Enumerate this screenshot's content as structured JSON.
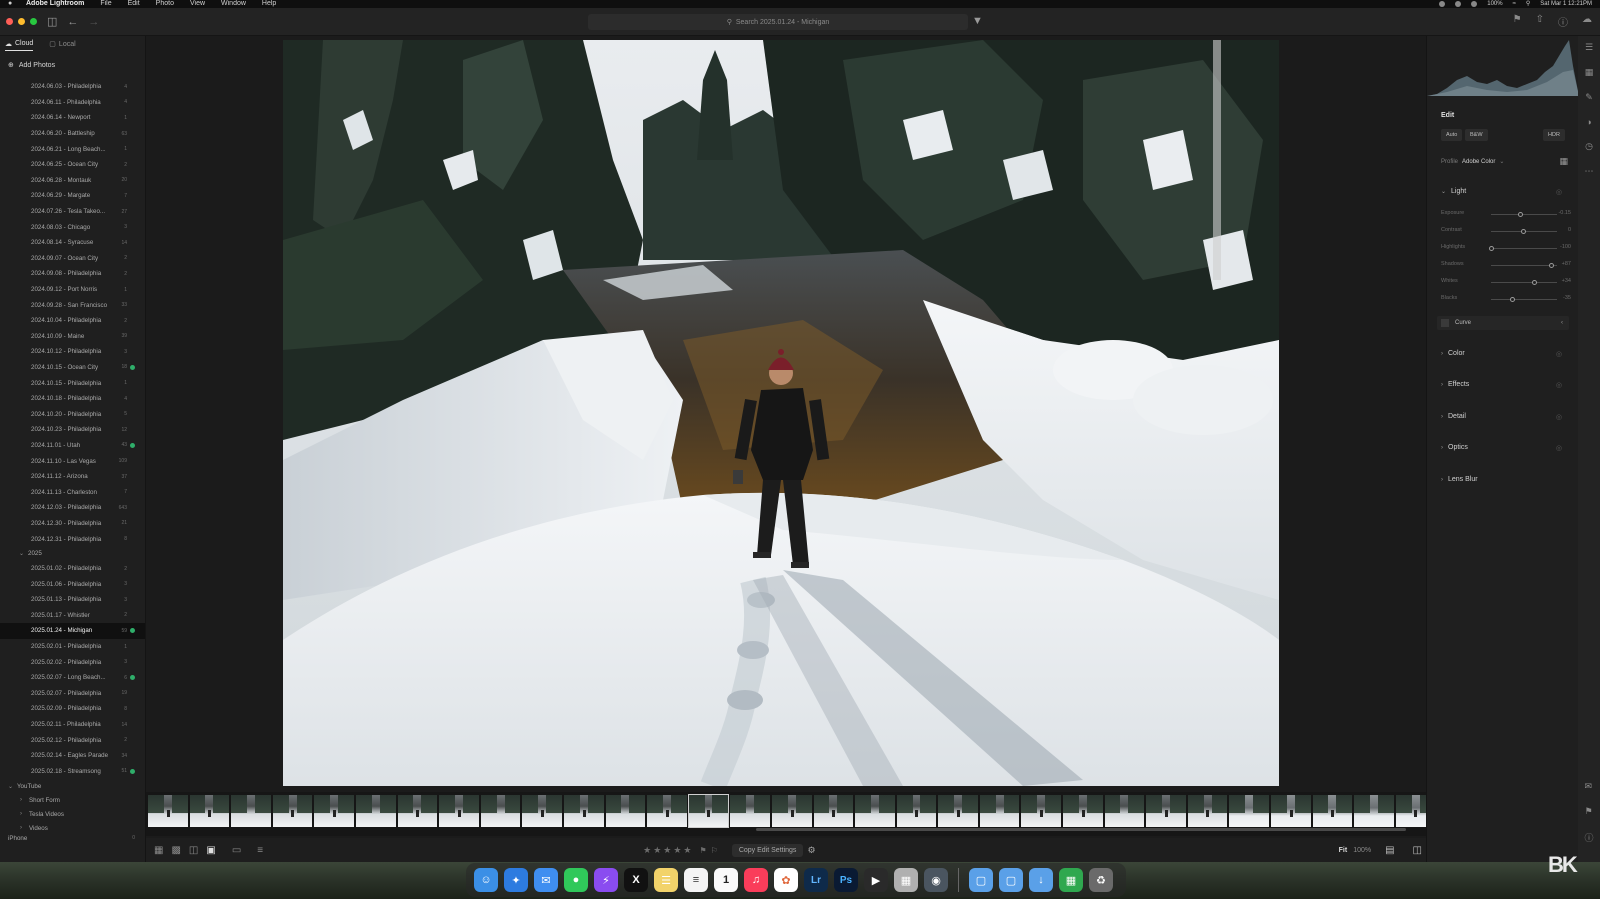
{
  "menubar": {
    "app_name": "Adobe Lightroom",
    "menus": [
      "File",
      "Edit",
      "Photo",
      "View",
      "Window",
      "Help"
    ],
    "battery": "100%",
    "datetime": "Sat Mar 1  12:21PM"
  },
  "topbar": {
    "search_placeholder": "Search 2025.01.24 - Michigan"
  },
  "left_panel": {
    "tabs": [
      {
        "label": "Cloud",
        "active": true
      },
      {
        "label": "Local",
        "active": false
      }
    ],
    "add_photos_label": "Add Photos",
    "albums_2024": [
      {
        "name": "2024.06.03 - Philadelphia",
        "count": "4"
      },
      {
        "name": "2024.06.11 - Philadelphia",
        "count": "4"
      },
      {
        "name": "2024.06.14 - Newport",
        "count": "1"
      },
      {
        "name": "2024.06.20 - Battleship",
        "count": "63"
      },
      {
        "name": "2024.06.21 - Long Beach...",
        "count": "1"
      },
      {
        "name": "2024.06.25 - Ocean City",
        "count": "2"
      },
      {
        "name": "2024.06.28 - Montauk",
        "count": "20"
      },
      {
        "name": "2024.06.29 - Margate",
        "count": "7"
      },
      {
        "name": "2024.07.26 - Tesla Takeo...",
        "count": "27"
      },
      {
        "name": "2024.08.03 - Chicago",
        "count": "3"
      },
      {
        "name": "2024.08.14 - Syracuse",
        "count": "14"
      },
      {
        "name": "2024.09.07 - Ocean City",
        "count": "2"
      },
      {
        "name": "2024.09.08 - Philadelphia",
        "count": "2"
      },
      {
        "name": "2024.09.12 - Port Norris",
        "count": "1"
      },
      {
        "name": "2024.09.28 - San Francisco",
        "count": "33"
      },
      {
        "name": "2024.10.04 - Philadelphia",
        "count": "2"
      },
      {
        "name": "2024.10.09 - Maine",
        "count": "39"
      },
      {
        "name": "2024.10.12 - Philadelphia",
        "count": "3"
      },
      {
        "name": "2024.10.15 - Ocean City",
        "count": "18",
        "synced": true
      },
      {
        "name": "2024.10.15 - Philadelphia",
        "count": "1"
      },
      {
        "name": "2024.10.18 - Philadelphia",
        "count": "4"
      },
      {
        "name": "2024.10.20 - Philadelphia",
        "count": "5"
      },
      {
        "name": "2024.10.23 - Philadelphia",
        "count": "12"
      },
      {
        "name": "2024.11.01 - Utah",
        "count": "43",
        "synced": true
      },
      {
        "name": "2024.11.10 - Las Vegas",
        "count": "109"
      },
      {
        "name": "2024.11.12 - Arizona",
        "count": "37"
      },
      {
        "name": "2024.11.13 - Charleston",
        "count": "7"
      },
      {
        "name": "2024.12.03 - Philadelphia",
        "count": "643"
      },
      {
        "name": "2024.12.30 - Philadelphia",
        "count": "21"
      },
      {
        "name": "2024.12.31 - Philadelphia",
        "count": "8"
      }
    ],
    "year_2025_label": "2025",
    "albums_2025": [
      {
        "name": "2025.01.02 - Philadelphia",
        "count": "2"
      },
      {
        "name": "2025.01.06 - Philadelphia",
        "count": "3"
      },
      {
        "name": "2025.01.13 - Philadelphia",
        "count": "3"
      },
      {
        "name": "2025.01.17 - Whistler",
        "count": "2"
      },
      {
        "name": "2025.01.24 - Michigan",
        "count": "59",
        "synced": true,
        "active": true
      },
      {
        "name": "2025.02.01 - Philadelphia",
        "count": "1"
      },
      {
        "name": "2025.02.02 - Philadelphia",
        "count": "3"
      },
      {
        "name": "2025.02.07 - Long Beach...",
        "count": "6",
        "synced": true
      },
      {
        "name": "2025.02.07 - Philadelphia",
        "count": "19"
      },
      {
        "name": "2025.02.09 - Philadelphia",
        "count": "8"
      },
      {
        "name": "2025.02.11 - Philadelphia",
        "count": "14"
      },
      {
        "name": "2025.02.12 - Philadelphia",
        "count": "2"
      },
      {
        "name": "2025.02.14 - Eagles Parade",
        "count": "34"
      },
      {
        "name": "2025.02.18 - Streamsong",
        "count": "51",
        "synced": true
      }
    ],
    "youtube_label": "YouTube",
    "youtube_children": [
      "Short Form",
      "Tesla Videos",
      "Videos"
    ],
    "iphone_label": "iPhone",
    "iphone_count": "0"
  },
  "bottom_bar": {
    "copy_edit_label": "Copy Edit Settings",
    "fit_label": "Fit",
    "zoom_label": "100%"
  },
  "edit_panel": {
    "title": "Edit",
    "chips": [
      "Auto",
      "B&W",
      "HDR"
    ],
    "profile_label": "Profile",
    "profile_value": "Adobe Color",
    "light_label": "Light",
    "sliders": [
      {
        "label": "Exposure",
        "value": "-0.15",
        "pos": 0.46
      },
      {
        "label": "Contrast",
        "value": "0",
        "pos": 0.5
      },
      {
        "label": "Highlights",
        "value": "-100",
        "pos": 0.02
      },
      {
        "label": "Shadows",
        "value": "+87",
        "pos": 0.92
      },
      {
        "label": "Whites",
        "value": "+34",
        "pos": 0.66
      },
      {
        "label": "Blacks",
        "value": "-35",
        "pos": 0.33
      }
    ],
    "curve_label": "Curve",
    "sections": [
      "Color",
      "Effects",
      "Detail",
      "Optics",
      "Lens Blur"
    ]
  },
  "filmstrip": {
    "count": 31,
    "selected_index": 13
  },
  "watermark": "BK",
  "calendar_day": "1"
}
